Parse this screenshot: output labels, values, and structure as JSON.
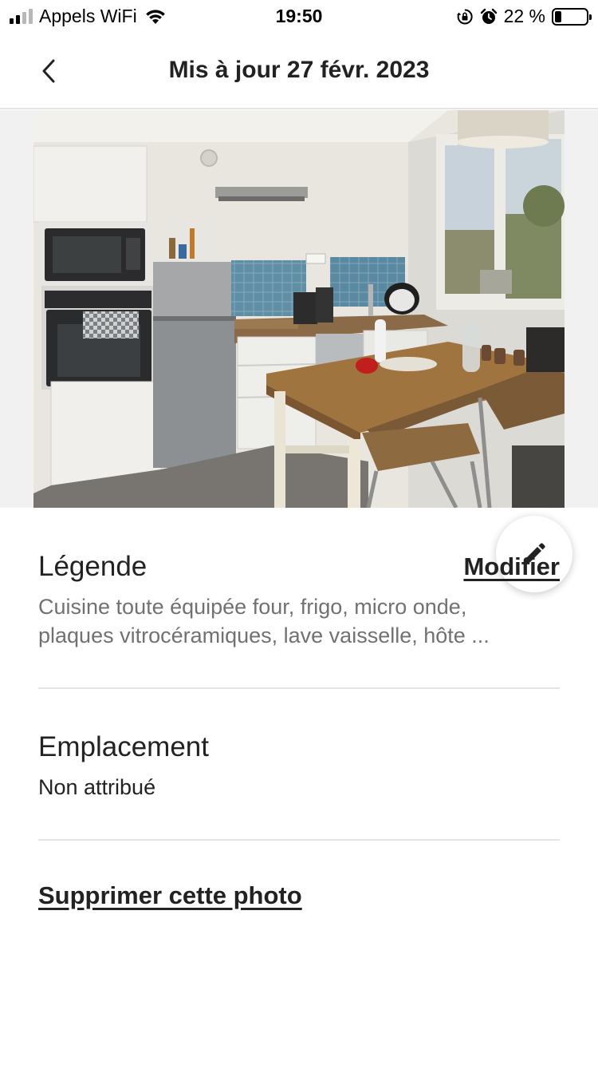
{
  "status_bar": {
    "carrier": "Appels WiFi",
    "time": "19:50",
    "battery_text": "22 %",
    "battery_level_percent": 22,
    "icons": [
      "signal-icon",
      "wifi-icon",
      "orientation-lock-icon",
      "alarm-icon",
      "battery-icon"
    ]
  },
  "header": {
    "title": "Mis à jour 27 févr. 2023",
    "back_icon": "chevron-left-icon"
  },
  "photo": {
    "subject": "kitchen-photo",
    "edit_icon": "pencil-icon"
  },
  "caption_section": {
    "title": "Légende",
    "edit_label": "Modifier",
    "text_line1": "Cuisine toute équipée four, frigo, micro onde,",
    "text_line2": "plaques vitrocéramiques, lave vaisselle, hôte ..."
  },
  "location_section": {
    "title": "Emplacement",
    "value": "Non attribué"
  },
  "delete_label": "Supprimer cette photo",
  "colors": {
    "text_primary": "#222222",
    "text_secondary": "#717171",
    "divider": "#e4e4e4",
    "photo_background": "#f1f1f1"
  }
}
